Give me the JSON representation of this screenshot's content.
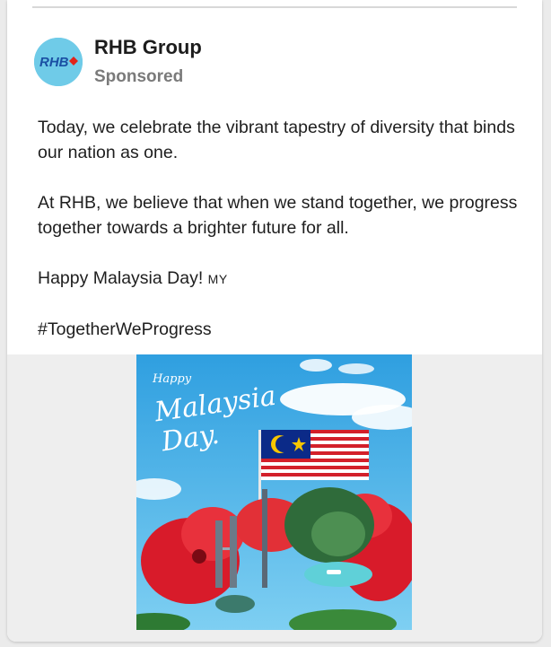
{
  "post": {
    "author": "RHB Group",
    "label": "Sponsored",
    "paragraphs": [
      "Today, we celebrate the vibrant tapestry of diversity that binds our nation as one.",
      "At RHB, we believe that when we stand together, we progress together towards a brighter future for all."
    ],
    "greeting": "Happy Malaysia Day!",
    "flag_code": "MY",
    "hashtag": "#TogetherWeProgress"
  },
  "avatar": {
    "logo_text": "RHB",
    "icon": "rhb-logo-icon"
  },
  "poster": {
    "line1": "Happy",
    "line2": "Malaysia",
    "line3": "Day."
  },
  "colors": {
    "avatar_bg": "#6fcbe8",
    "logo_blue": "#1a4fa3",
    "logo_red": "#e2231a",
    "sky": "#3aa9e0"
  }
}
